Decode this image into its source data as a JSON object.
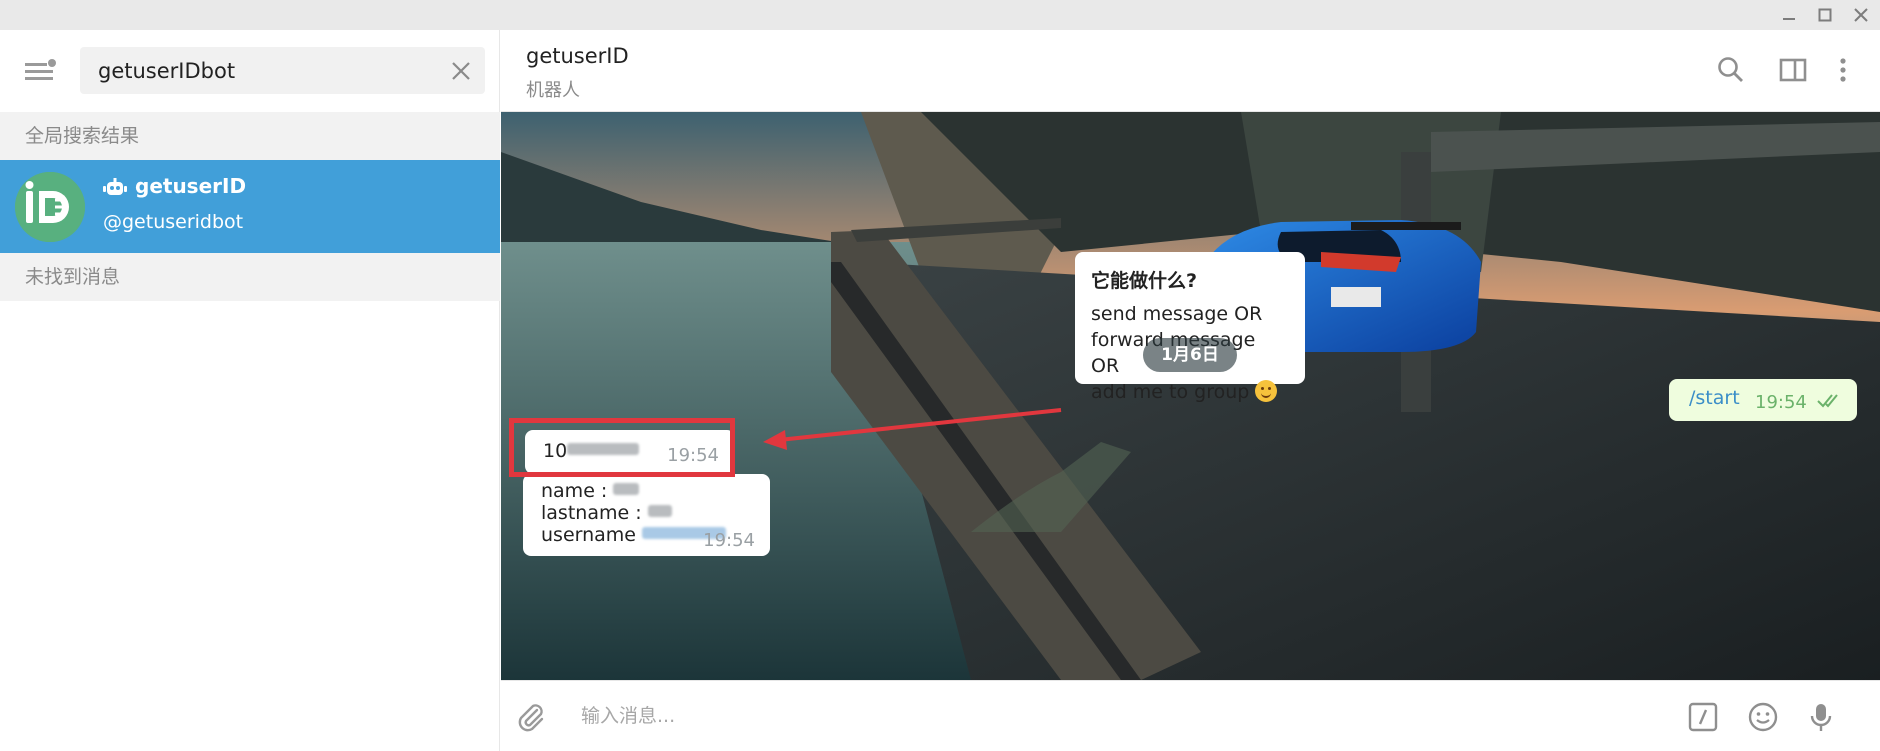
{
  "app": {
    "window_buttons": [
      "minimize-icon",
      "maximize-icon",
      "close-icon"
    ]
  },
  "sidebar": {
    "search": {
      "value": "getuserIDbot",
      "placeholder": ""
    },
    "global_results_label": "全局搜索结果",
    "result": {
      "name": "getuserID",
      "handle": "@getuseridbot",
      "icon": "robot-icon",
      "avatar_color": "#58b07f"
    },
    "no_messages_label": "未找到消息",
    "selected_color": "#419fd9"
  },
  "chat": {
    "title": "getuserID",
    "subtitle": "机器人",
    "header_icons": [
      "search-icon",
      "sidebar-toggle-icon",
      "more-vertical-icon"
    ],
    "intro": {
      "heading": "它能做什么?",
      "lines": [
        "send message  OR",
        "forward message  OR",
        "add me to group"
      ]
    },
    "date_label": "1月6日",
    "messages": {
      "outgoing": {
        "text": "/start",
        "time": "19:54"
      },
      "user_id": {
        "prefix": "10",
        "time": "19:54"
      },
      "info": {
        "name_label": "name :",
        "lastname_label": "lastname :",
        "username_label": "username",
        "time": "19:54"
      }
    },
    "annotation_color": "#e1373e"
  },
  "composer": {
    "placeholder": "输入消息...",
    "icons": [
      "attach-icon",
      "bot-command-icon",
      "emoji-icon",
      "microphone-icon"
    ]
  }
}
